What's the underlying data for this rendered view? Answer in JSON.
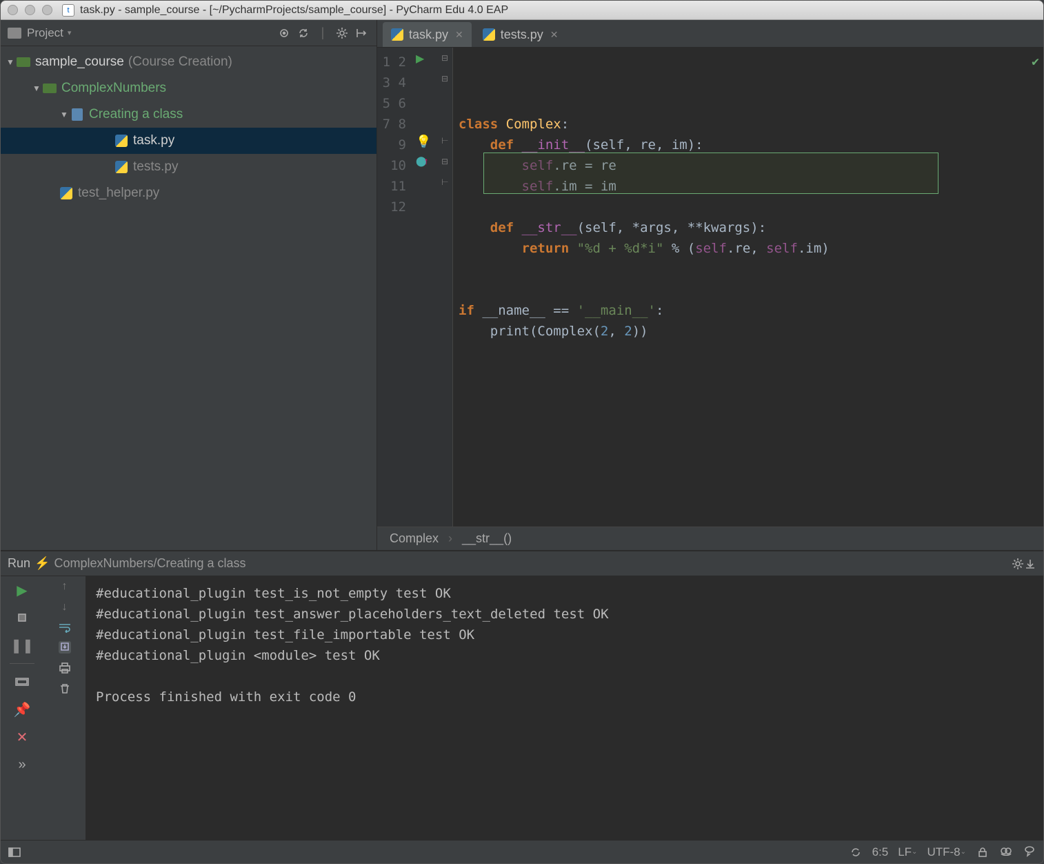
{
  "window": {
    "title": "task.py - sample_course - [~/PycharmProjects/sample_course] - PyCharm Edu 4.0 EAP"
  },
  "project_tool": {
    "label": "Project",
    "icons": [
      "target",
      "sync",
      "divider",
      "gear",
      "collapse"
    ]
  },
  "tree": {
    "root": {
      "name": "sample_course",
      "suffix": "(Course Creation)"
    },
    "items": [
      {
        "name": "ComplexNumbers",
        "kind": "lesson"
      },
      {
        "name": "Creating a class",
        "kind": "task"
      },
      {
        "name": "task.py",
        "kind": "py",
        "selected": true
      },
      {
        "name": "tests.py",
        "kind": "py"
      },
      {
        "name": "test_helper.py",
        "kind": "py"
      }
    ]
  },
  "tabs": [
    {
      "label": "task.py",
      "active": true
    },
    {
      "label": "tests.py",
      "active": false
    }
  ],
  "gutter_lines": [
    "1",
    "2",
    "3",
    "4",
    "5",
    "6",
    "7",
    "8",
    "9",
    "10",
    "11",
    "12"
  ],
  "code_tokens": {
    "l1": {
      "class": "class ",
      "name": "Complex",
      "colon": ":"
    },
    "l2": {
      "def": "    def ",
      "fn": "__init__",
      "sig": "(self, re, im):"
    },
    "l3": "        self.re = re",
    "l4": "        self.im = im",
    "l5": "",
    "l6": {
      "def": "    def ",
      "fn": "__str__",
      "sig": "(self, *args, **kwargs):"
    },
    "l7": {
      "ret": "        return ",
      "str": "\"%d + %d*i\"",
      "rest": " % (self.re, self.im)"
    },
    "l8": "",
    "l9": "",
    "l10a": "if ",
    "l10b": "__name__",
    "l10c": " == ",
    "l10d": "'__main__'",
    "l10e": ":",
    "l11a": "    print(",
    "l11b": "Complex",
    "l11c": "(",
    "l11d": "2",
    "l11e": ", ",
    "l11f": "2",
    "l11g": "))",
    "l12": ""
  },
  "breadcrumb": {
    "a": "Complex",
    "b": "__str__()"
  },
  "run": {
    "label": "Run",
    "config": "ComplexNumbers/Creating a class",
    "output": "#educational_plugin test_is_not_empty test OK\n#educational_plugin test_answer_placeholders_text_deleted test OK\n#educational_plugin test_file_importable test OK\n#educational_plugin <module> test OK\n\nProcess finished with exit code 0"
  },
  "statusbar": {
    "pos": "6:5",
    "le": "LF",
    "enc": "UTF-8"
  }
}
